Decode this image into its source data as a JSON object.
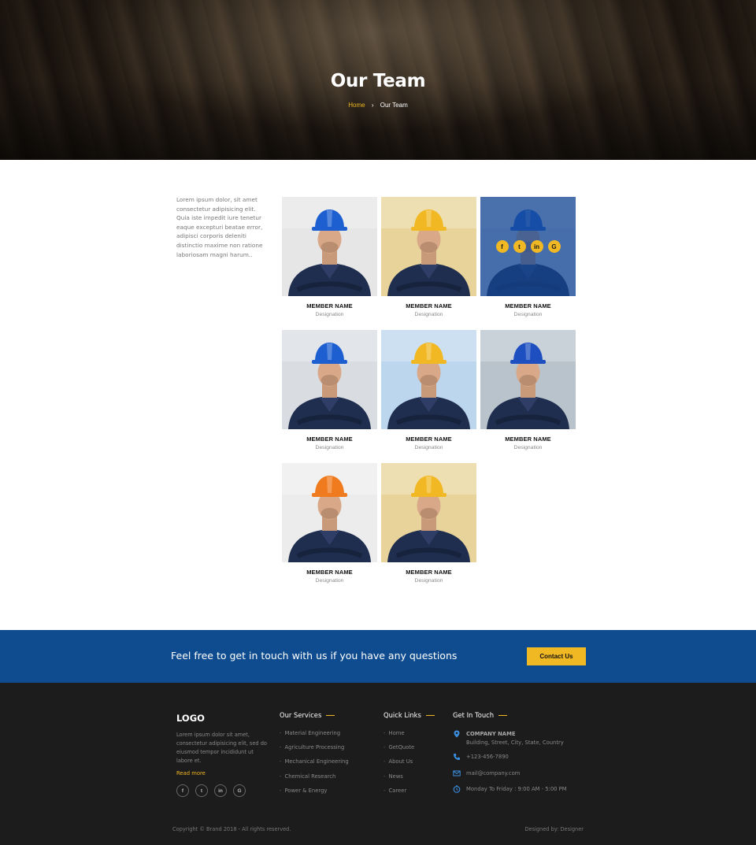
{
  "hero": {
    "title": "Our Team",
    "breadcrumb_home": "Home",
    "breadcrumb_separator": "›",
    "breadcrumb_current": "Our Team"
  },
  "intro": {
    "text": "Lorem ipsum dolor, sit amet consectetur adipisicing elit. Quia iste impedit iure tenetur eaque excepturi beatae error, adipisci corporis deleniti distinctio maxime non ratione laboriosam magni harum.."
  },
  "team": [
    {
      "name": "MEMBER NAME",
      "role": "Designation",
      "helmet": "#1d5fd1",
      "bg": "#e6e6e6"
    },
    {
      "name": "MEMBER NAME",
      "role": "Designation",
      "helmet": "#f1b824",
      "bg": "#e8d49a"
    },
    {
      "name": "MEMBER NAME",
      "role": "Designation",
      "helmet": "#1d5fd1",
      "bg": "#c9d4de",
      "hover": true
    },
    {
      "name": "MEMBER NAME",
      "role": "Designation",
      "helmet": "#1d5fd1",
      "bg": "#d9dde2"
    },
    {
      "name": "MEMBER NAME",
      "role": "Designation",
      "helmet": "#f1b824",
      "bg": "#bcd6ee"
    },
    {
      "name": "MEMBER NAME",
      "role": "Designation",
      "helmet": "#1d4fc1",
      "bg": "#b8c3cc"
    },
    {
      "name": "MEMBER NAME",
      "role": "Designation",
      "helmet": "#f07b1f",
      "bg": "#ececec"
    },
    {
      "name": "MEMBER NAME",
      "role": "Designation",
      "helmet": "#f1b824",
      "bg": "#e8d49a"
    }
  ],
  "hover_social": [
    "f",
    "t",
    "in",
    "G"
  ],
  "cta": {
    "text": "Feel free to get in touch with us if you have any questions",
    "button": "Contact Us"
  },
  "footer": {
    "logo": "LOGO",
    "description": "Lorem ipsum dolor sit amet, consectetur adipisicing elit, sed do eiusmod tempor incididunt ut labore et.",
    "read_more": "Read more",
    "social": [
      "f",
      "t",
      "in",
      "G"
    ],
    "services_title": "Our Services",
    "services": [
      "Material Engineering",
      "Agriculture Processing",
      "Mechanical Engineering",
      "Chemical Research",
      "Power & Energy"
    ],
    "links_title": "Quick Links",
    "links": [
      "Home",
      "GetQuote",
      "About Us",
      "News",
      "Career"
    ],
    "contact_title": "Get In Touch",
    "company_name": "COMPANY NAME",
    "address": "Building, Street, City, State, Country",
    "phone": "+123-456-7890",
    "email": "mail@company.com",
    "hours": "Monday To Friday : 9:00 AM - 5:00 PM",
    "copyright": "Copyright © Brand 2018 - All rights reserved.",
    "designed_by": "Designed by: Designer"
  },
  "colors": {
    "accent": "#f0b823",
    "cta_bg": "#0f4c8f",
    "footer_bg": "#1c1c1c"
  }
}
